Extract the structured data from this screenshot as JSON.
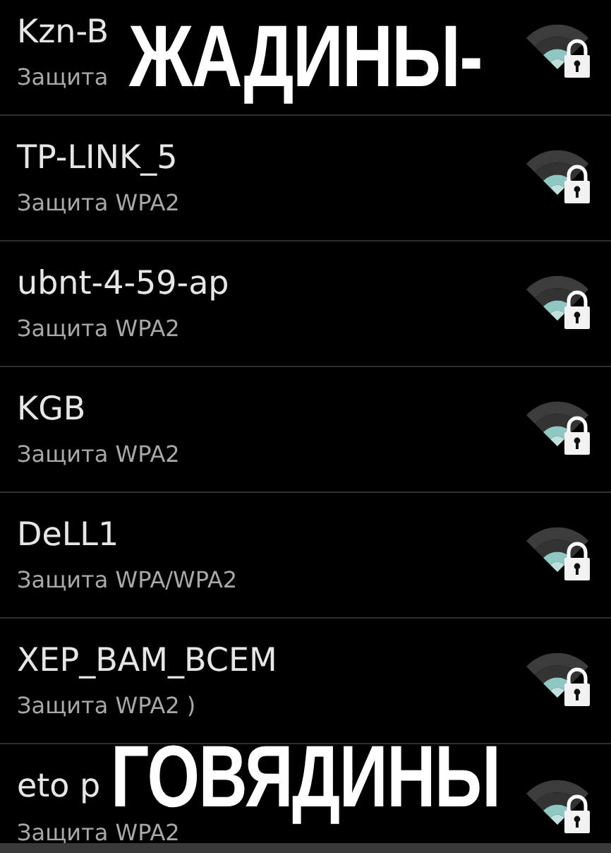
{
  "networks": [
    {
      "name": "Kzn-B",
      "security": "Защита"
    },
    {
      "name": "TP-LINK_5",
      "security": "Защита WPA2"
    },
    {
      "name": "ubnt-4-59-ap",
      "security": "Защита WPA2"
    },
    {
      "name": "KGB",
      "security": "Защита WPA2"
    },
    {
      "name": "DeLL1",
      "security": "Защита WPA/WPA2"
    },
    {
      "name": "XEP_BAM_BCEM",
      "security": "Защита WPA2 )"
    },
    {
      "name": "eto p",
      "security": "Защита WPA2"
    }
  ],
  "top_caption": "ЖАДИНЫ-",
  "bottom_caption": "ГОВЯДИНЫ"
}
